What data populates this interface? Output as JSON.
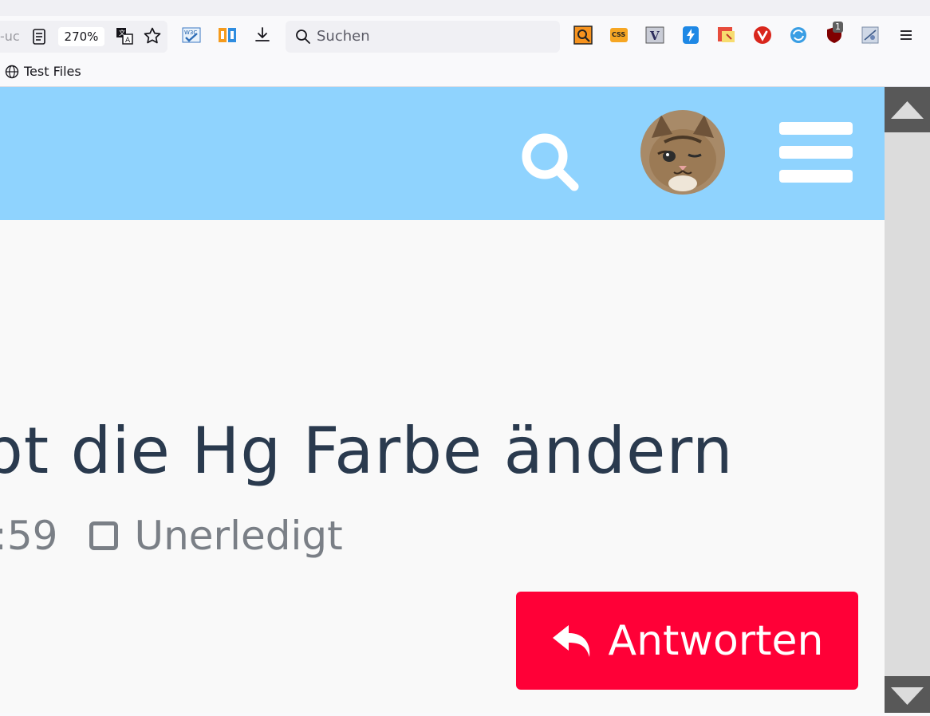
{
  "browser": {
    "url_fragment": "-uc",
    "zoom": "270%",
    "search_placeholder": "Suchen",
    "extension_badge": "1",
    "bookmarks": [
      {
        "label": "Test Files"
      }
    ]
  },
  "page": {
    "title_fragment": "pt die Hg Farbe ändern",
    "time_fragment": ":59",
    "status": "Unerledigt",
    "reply_label": "Antworten",
    "colors": {
      "header": "#8fd3fe",
      "reply_button": "#ff0037",
      "title_text": "#2a3a4e"
    }
  }
}
